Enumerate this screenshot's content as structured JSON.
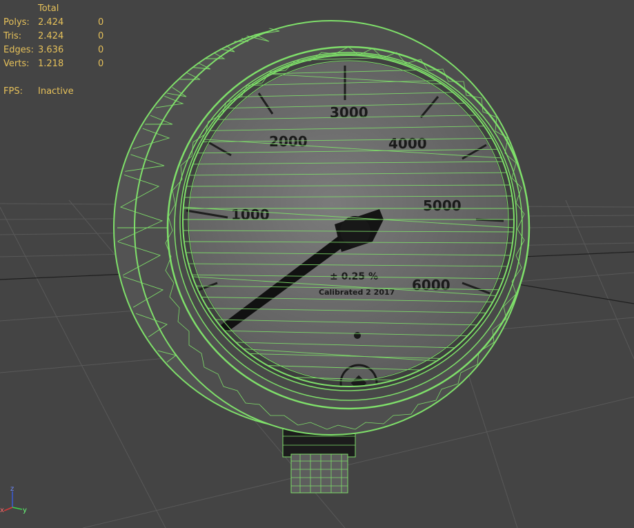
{
  "stats": {
    "header": "Total",
    "rows": [
      {
        "label": "Polys:",
        "total": "2.424",
        "selected": "0"
      },
      {
        "label": "Tris:",
        "total": "2.424",
        "selected": "0"
      },
      {
        "label": "Edges:",
        "total": "3.636",
        "selected": "0"
      },
      {
        "label": "Verts:",
        "total": "1.218",
        "selected": "0"
      }
    ],
    "fps_label": "FPS:",
    "fps_value": "Inactive"
  },
  "dial": {
    "labels": [
      "1000",
      "2000",
      "3000",
      "4000",
      "5000",
      "6000"
    ],
    "text_line1": "± 0.25 %",
    "text_line2": "Calibrated 2 2017"
  },
  "gizmo": {
    "x": "x",
    "y": "y",
    "z": "z"
  },
  "colors": {
    "background": "#444444",
    "grid": "#5a5a5a",
    "wire": "#7fe06a",
    "stats_text": "#e6c15a"
  }
}
